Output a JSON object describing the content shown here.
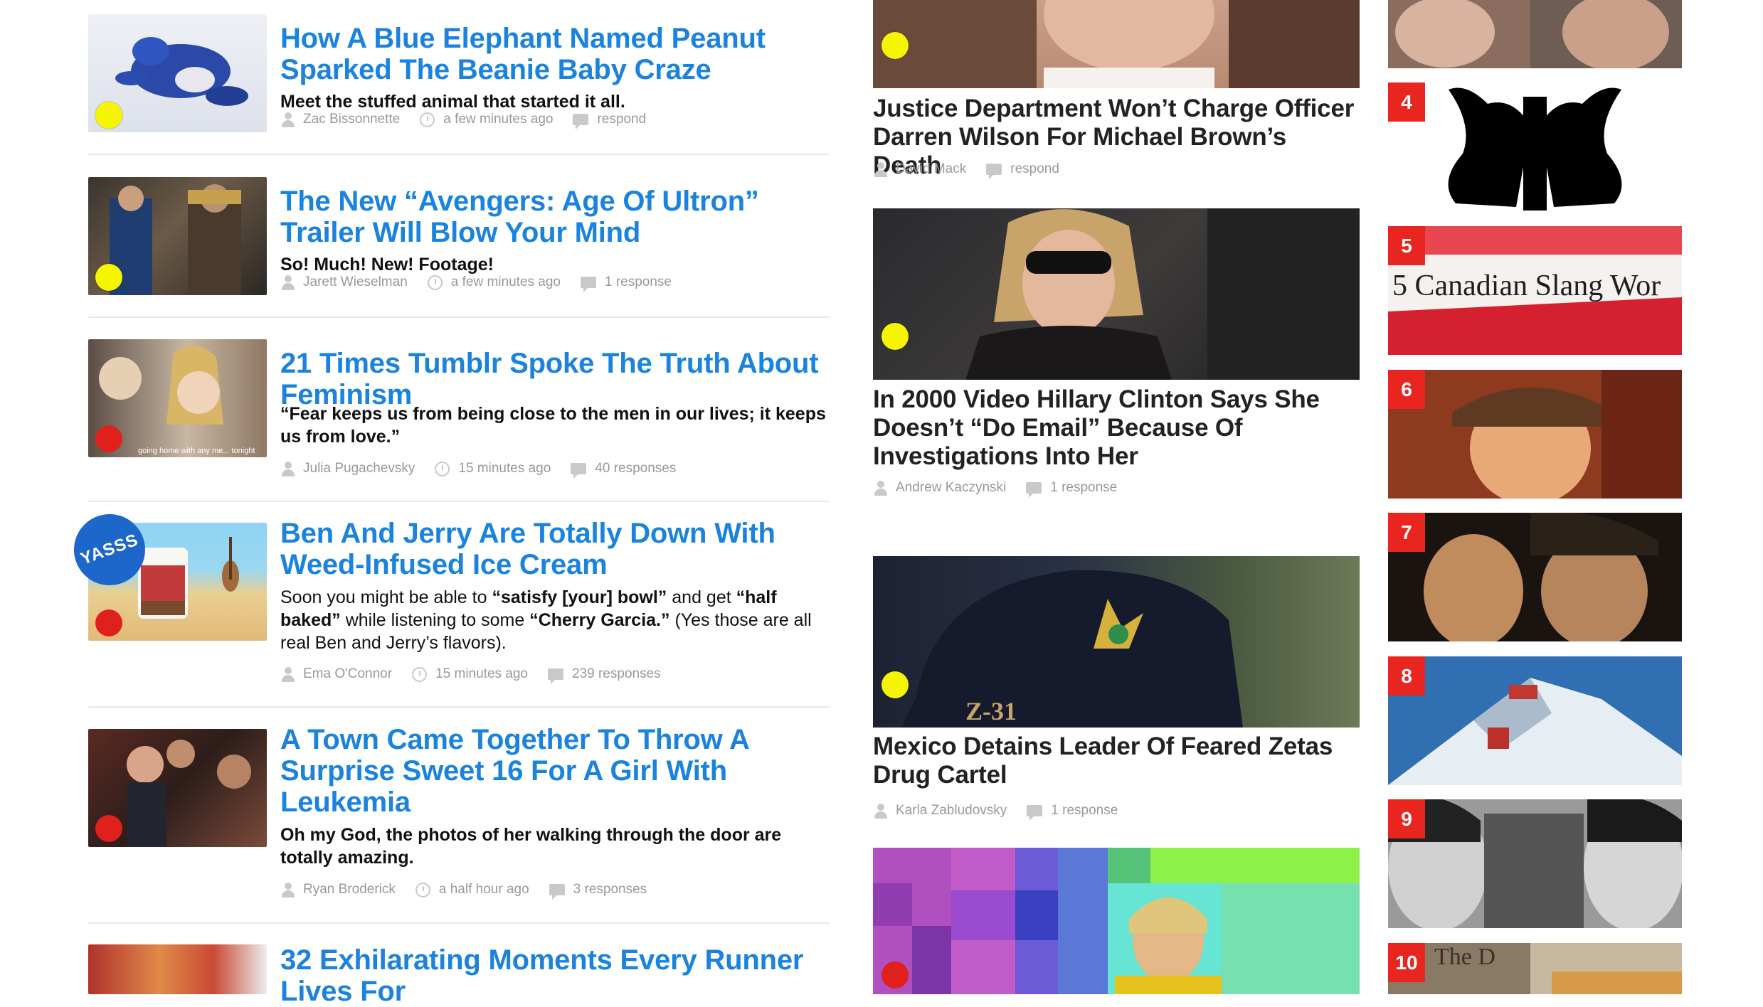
{
  "left_feed": [
    {
      "title": "How A Blue Elephant Named Peanut Sparked The Beanie Baby Craze",
      "desc_parts": [
        {
          "t": "Meet the stuffed animal that started it all.",
          "b": true
        }
      ],
      "author": "Zac Bissonnette",
      "time": "a few minutes ago",
      "responses": "respond",
      "dot": "yellow"
    },
    {
      "title": "The New “Avengers: Age Of Ultron” Trailer Will Blow Your Mind",
      "desc_parts": [
        {
          "t": "So! Much! New! Footage!",
          "b": true
        }
      ],
      "author": "Jarett Wieselman",
      "time": "a few minutes ago",
      "responses": "1 response",
      "dot": "yellow"
    },
    {
      "title": "21 Times Tumblr Spoke The Truth About Feminism",
      "desc_parts": [
        {
          "t": "“Fear keeps us from being close to the men in our lives; it keeps us from love.”",
          "b": true
        }
      ],
      "author": "Julia Pugachevsky",
      "time": "15 minutes ago",
      "responses": "40 responses",
      "dot": "red",
      "thumb_caption": "going home with any me... tonight"
    },
    {
      "title": "Ben And Jerry Are Totally Down With Weed-Infused Ice Cream",
      "desc_parts": [
        {
          "t": "Soon you might be able to ",
          "b": false
        },
        {
          "t": "“satisfy [your] bowl”",
          "b": true
        },
        {
          "t": " and get ",
          "b": false
        },
        {
          "t": "“half baked”",
          "b": true
        },
        {
          "t": " while listening to some ",
          "b": false
        },
        {
          "t": "“Cherry Garcia.”",
          "b": true
        },
        {
          "t": " (Yes those are all real Ben and Jerry’s flavors).",
          "b": false
        }
      ],
      "author": "Ema O'Connor",
      "time": "15 minutes ago",
      "responses": "239 responses",
      "dot": "red",
      "badge": "YASSS"
    },
    {
      "title": "A Town Came Together To Throw A Surprise Sweet 16 For A Girl With Leukemia",
      "desc_parts": [
        {
          "t": "Oh my God, the photos of her walking through the door are totally amazing.",
          "b": true
        }
      ],
      "author": "Ryan Broderick",
      "time": "a half hour ago",
      "responses": "3 responses",
      "dot": "red"
    },
    {
      "title": "32 Exhilarating Moments Every Runner Lives For",
      "desc_parts": [],
      "author": "",
      "time": "",
      "responses": "",
      "dot": ""
    }
  ],
  "mid_feed": [
    {
      "title": "Justice Department Won’t Charge Officer Darren Wilson For Michael Brown’s Death",
      "author": "David Mack",
      "responses": "respond",
      "dot": "yellow"
    },
    {
      "title": "In 2000 Video Hillary Clinton Says She Doesn’t “Do Email” Because Of Investigations Into Her",
      "author": "Andrew Kaczynski",
      "responses": "1 response",
      "dot": "yellow"
    },
    {
      "title": "Mexico Detains Leader Of Feared Zetas Drug Cartel",
      "author": "Karla Zabludovsky",
      "responses": "1 response",
      "dot": "yellow",
      "img_text": "Z-31"
    },
    {
      "title": "",
      "author": "",
      "responses": "",
      "dot": "red"
    }
  ],
  "rail": [
    {
      "num": ""
    },
    {
      "num": "4"
    },
    {
      "num": "5",
      "img_text": "5 Canadian Slang Wor"
    },
    {
      "num": "6"
    },
    {
      "num": "7"
    },
    {
      "num": "8"
    },
    {
      "num": "9"
    },
    {
      "num": "10",
      "img_text": "The D"
    }
  ],
  "colors": {
    "headline_blue": "#1a83dd",
    "badge_red": "#e8261f",
    "dot_yellow": "#f5f500",
    "dot_red": "#e0201c",
    "meta_gray": "#999999"
  }
}
